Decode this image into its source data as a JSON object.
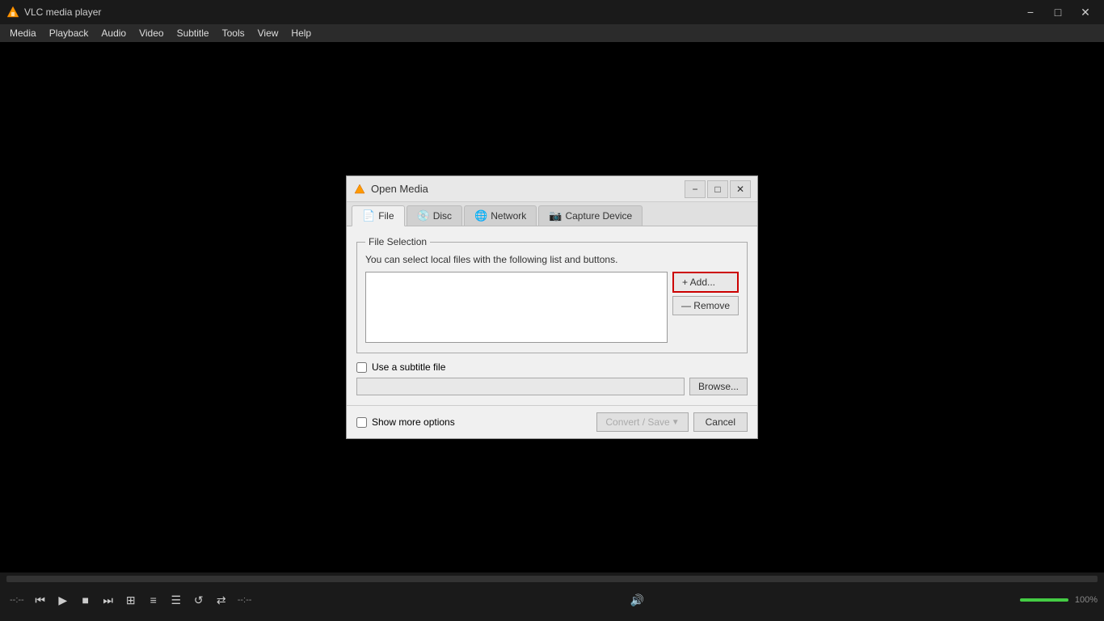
{
  "app": {
    "title": "VLC media player",
    "icon": "🎭"
  },
  "titlebar": {
    "minimize": "−",
    "maximize": "□",
    "close": "✕"
  },
  "menubar": {
    "items": [
      "Media",
      "Playback",
      "Audio",
      "Video",
      "Subtitle",
      "Tools",
      "View",
      "Help"
    ]
  },
  "dialog": {
    "title": "Open Media",
    "minimize": "−",
    "maximize": "□",
    "close": "✕",
    "tabs": [
      {
        "id": "file",
        "label": "File",
        "icon": "📄",
        "active": true
      },
      {
        "id": "disc",
        "label": "Disc",
        "icon": "💿",
        "active": false
      },
      {
        "id": "network",
        "label": "Network",
        "icon": "🌐",
        "active": false
      },
      {
        "id": "capture",
        "label": "Capture Device",
        "icon": "📷",
        "active": false
      }
    ],
    "fileSelection": {
      "legend": "File Selection",
      "description": "You can select local files with the following list and buttons.",
      "addLabel": "+ Add...",
      "removeLabel": "— Remove"
    },
    "subtitle": {
      "checkboxLabel": "Use a subtitle file",
      "browsLabel": "Browse..."
    },
    "footer": {
      "showMoreLabel": "Show more options",
      "convertSaveLabel": "Convert / Save",
      "cancelLabel": "Cancel"
    }
  },
  "bottomBar": {
    "timeLeft": "--:--",
    "timeRight": "--:--",
    "volumePercent": "100%"
  },
  "controls": {
    "play": "▶",
    "skipBack": "⏮",
    "stop": "■",
    "skipForward": "⏭",
    "frame": "⊞",
    "eq": "≡",
    "playlist": "☰",
    "loop": "↺",
    "random": "⇄",
    "volumeIcon": "🔊"
  }
}
